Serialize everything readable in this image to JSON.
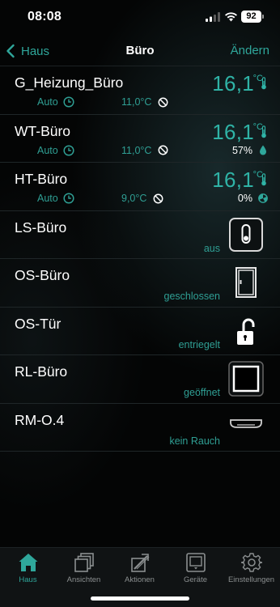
{
  "status_bar": {
    "time": "08:08",
    "battery": "92",
    "icons": [
      "signal-icon",
      "wifi-icon",
      "battery-icon"
    ]
  },
  "nav": {
    "back_label": "Haus",
    "title": "Büro",
    "edit_label": "Ändern",
    "accent_color": "#2fa79b"
  },
  "rows": [
    {
      "name": "G_Heizung_Büro",
      "mode": "Auto",
      "setpoint": "11,0°C",
      "temperature": "16,1",
      "unit": "°C"
    },
    {
      "name": "WT-Büro",
      "mode": "Auto",
      "setpoint": "11,0°C",
      "temperature": "16,1",
      "unit": "°C",
      "humidity": "57%"
    },
    {
      "name": "HT-Büro",
      "mode": "Auto",
      "setpoint": "9,0°C",
      "temperature": "16,1",
      "unit": "°C",
      "valve": "0%"
    },
    {
      "name": "LS-Büro",
      "status": "aus",
      "icon": "light-switch-icon"
    },
    {
      "name": "OS-Büro",
      "status": "geschlossen",
      "icon": "window-closed-icon"
    },
    {
      "name": "OS-Tür",
      "status": "entriegelt",
      "icon": "unlocked-padlock-icon"
    },
    {
      "name": "RL-Büro",
      "status": "geöffnet",
      "icon": "shutter-open-icon"
    },
    {
      "name": "RM-O.4",
      "status": "kein Rauch",
      "icon": "smoke-detector-icon"
    }
  ],
  "tabs": [
    {
      "label": "Haus",
      "icon": "house-icon",
      "active": true
    },
    {
      "label": "Ansichten",
      "icon": "views-icon",
      "active": false
    },
    {
      "label": "Aktionen",
      "icon": "actions-icon",
      "active": false
    },
    {
      "label": "Geräte",
      "icon": "devices-icon",
      "active": false
    },
    {
      "label": "Einstellungen",
      "icon": "gear-icon",
      "active": false
    }
  ]
}
